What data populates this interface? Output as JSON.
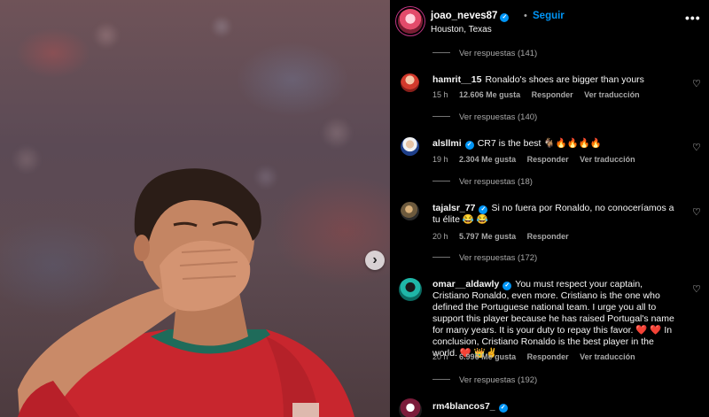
{
  "post": {
    "username": "joao_neves87",
    "separator": "•",
    "follow_label": "Seguir",
    "location": "Houston, Texas",
    "more_label": "•••"
  },
  "photo": {
    "next_label": "›"
  },
  "replies": [
    "Ver respuestas (141)",
    "Ver respuestas (140)",
    "Ver respuestas (18)",
    "Ver respuestas (172)",
    "Ver respuestas (192)"
  ],
  "comments": [
    {
      "username": "hamrit__15",
      "text": "Ronaldo's shoes are bigger than yours",
      "time": "15 h",
      "likes": "12.606 Me gusta",
      "reply": "Responder",
      "translate": "Ver traducción"
    },
    {
      "username": "alsllmi",
      "text": "CR7 is the best 🐐🔥🔥🔥🔥",
      "time": "19 h",
      "likes": "2.304 Me gusta",
      "reply": "Responder",
      "translate": "Ver traducción"
    },
    {
      "username": "tajalsr_77",
      "text": "Si no fuera por Ronaldo, no conoceríamos a tu élite 😂 😂",
      "time": "20 h",
      "likes": "5.797 Me gusta",
      "reply": "Responder"
    },
    {
      "username": "omar__aldawly",
      "text": "You must respect your captain, Cristiano Ronaldo, even more. Cristiano is the one who defined the Portuguese national team. I urge you all to support this player because he has raised Portugal's name for many years. It is your duty to repay this favor. ❤️ ❤️ In conclusion, Cristiano Ronaldo is the best player in the world. ❤️ 👑✌️",
      "time": "20 h",
      "likes": "6.996 Me gusta",
      "reply": "Responder",
      "translate": "Ver traducción"
    },
    {
      "username": "rm4blancos7_"
    }
  ],
  "icons": {
    "heart": "♡",
    "verified": "✓"
  },
  "colors": {
    "background": "#000000",
    "accent_blue": "#0095f6",
    "muted_text": "#a8a8a8",
    "jersey_red": "#c8262e"
  }
}
